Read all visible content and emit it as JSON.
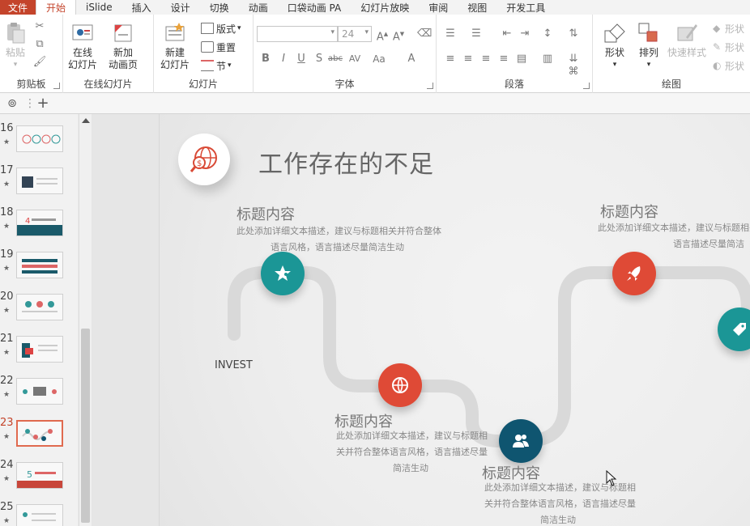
{
  "tabs": [
    "文件",
    "开始",
    "iSlide",
    "插入",
    "设计",
    "切换",
    "动画",
    "口袋动画 PA",
    "幻灯片放映",
    "审阅",
    "视图",
    "开发工具"
  ],
  "active_tab": "开始",
  "ribbon": {
    "clipboard": {
      "paste": "粘贴",
      "group": "剪贴板"
    },
    "online_slides": {
      "online_slide": "在线\n幻灯片",
      "new_anim_page": "新加\n动画页",
      "group": "在线幻灯片"
    },
    "slides": {
      "new_slide": "新建\n幻灯片",
      "layout": "版式",
      "reset": "重置",
      "section": "节",
      "group": "幻灯片"
    },
    "font": {
      "font_size": "24",
      "group": "字体"
    },
    "paragraph": {
      "group": "段落"
    },
    "drawing": {
      "shapes": "形状",
      "arrange": "排列",
      "quick_styles": "快速样式",
      "shape_fill": "形状",
      "shape_outline": "形状",
      "shape_effects": "形状",
      "group": "绘图"
    }
  },
  "thumbnails": [
    {
      "num": "16",
      "selected": false
    },
    {
      "num": "17",
      "selected": false
    },
    {
      "num": "18",
      "selected": false
    },
    {
      "num": "19",
      "selected": false
    },
    {
      "num": "20",
      "selected": false
    },
    {
      "num": "21",
      "selected": false
    },
    {
      "num": "22",
      "selected": false
    },
    {
      "num": "23",
      "selected": true
    },
    {
      "num": "24",
      "selected": false
    },
    {
      "num": "25",
      "selected": false
    }
  ],
  "thumb_star": "★",
  "slide": {
    "title": "工作存在的不足",
    "invest": "INVEST",
    "items": [
      {
        "heading": "标题内容",
        "desc1": "此处添加详细文本描述，建议与标题相关并符合整体",
        "desc2": "语言风格，语言描述尽量简洁生动"
      },
      {
        "heading": "标题内容",
        "desc1": "此处添加详细文本描述，建议与标题相",
        "desc2": "关并符合整体语言风格，语言描述尽量",
        "desc3": "简洁生动"
      },
      {
        "heading": "标题内容",
        "desc1": "此处添加详细文本描述，建议与标题相",
        "desc2": "关并符合整体语言风格，语言描述尽量",
        "desc3": "简洁生动"
      },
      {
        "heading": "标题内容",
        "desc1": "此处添加详细文本描述，建议与标题相关并符",
        "desc2": "语言描述尽量简洁"
      }
    ]
  },
  "colors": {
    "accent": "#c4442b",
    "teal": "#1b9696",
    "red": "#df4a36",
    "navy": "#0f5570"
  }
}
